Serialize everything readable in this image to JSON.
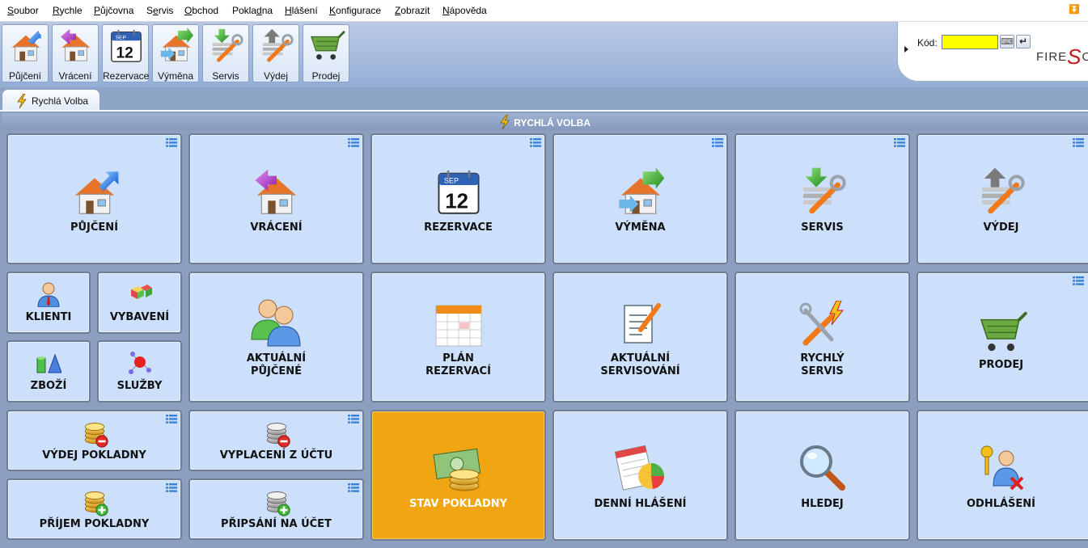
{
  "menu": [
    {
      "pre": "",
      "u": "S",
      "post": "oubor"
    },
    {
      "pre": "",
      "u": "R",
      "post": "ychle"
    },
    {
      "pre": "",
      "u": "P",
      "post": "ůjčovna"
    },
    {
      "pre": "S",
      "u": "e",
      "post": "rvis"
    },
    {
      "pre": "",
      "u": "O",
      "post": "bchod"
    },
    {
      "pre": "Pokla",
      "u": "d",
      "post": "na"
    },
    {
      "pre": "",
      "u": "H",
      "post": "lášení"
    },
    {
      "pre": "",
      "u": "K",
      "post": "onfigurace"
    },
    {
      "pre": "",
      "u": "Z",
      "post": "obrazit"
    },
    {
      "pre": "",
      "u": "N",
      "post": "ápověda"
    }
  ],
  "toolbar": [
    "Půjčení",
    "Vrácení",
    "Rezervace",
    "Výměna",
    "Servis",
    "Výdej",
    "Prodej"
  ],
  "code": {
    "label": "Kód:",
    "value": "",
    "logo_pre": "FIRE",
    "logo_s": "S",
    "logo_post": "OF"
  },
  "tab_label": "Rychlá Volba",
  "panel_title": "RYCHLÁ VOLBA",
  "calendar": {
    "month": "SEP",
    "day": "12"
  },
  "tiles": {
    "pujceni": "PŮJČENÍ",
    "vraceni": "VRÁCENÍ",
    "rezervace": "REZERVACE",
    "vymena": "VÝMĚNA",
    "servis": "SERVIS",
    "vydej": "VÝDEJ",
    "klienti": "KLIENTI",
    "vybaveni": "VYBAVENÍ",
    "zbozi": "ZBOŽÍ",
    "sluzby": "SLUŽBY",
    "aktualni_pujcene_1": "AKTUÁLNÍ",
    "aktualni_pujcene_2": "PŮJČENÉ",
    "plan_rezervaci_1": "PLÁN",
    "plan_rezervaci_2": "REZERVACÍ",
    "aktualni_servisovani_1": "AKTUÁLNÍ",
    "aktualni_servisovani_2": "SERVISOVÁNÍ",
    "rychly_servis_1": "RYCHLÝ",
    "rychly_servis_2": "SERVIS",
    "prodej": "PRODEJ",
    "vydej_pokladny": "VÝDEJ POKLADNY",
    "vyplaceni_z_uctu": "VYPLACENÍ Z ÚČTU",
    "stav_pokladny": "STAV POKLADNY",
    "denni_hlaseni": "DENNÍ HLÁŠENÍ",
    "hledej": "HLEDEJ",
    "odhlaseni": "ODHLÁŠENÍ",
    "prijem_pokladny": "PŘÍJEM POKLADNY",
    "pripsani_na_ucet": "PŘIPSÁNÍ NA ÚČET"
  },
  "colors": {
    "tile_bg": "#cce0fc",
    "tile_active": "#f2a512",
    "code_input": "#ffff00",
    "toolbar_bg": "#a7bbdd"
  },
  "icons": {
    "toolbar": [
      "house-arrow-icon",
      "house-return-icon",
      "calendar-icon",
      "exchange-icon",
      "service-tools-icon",
      "issue-tools-icon",
      "shopping-cart-icon"
    ],
    "tiles": [
      "house-arrow-icon",
      "house-return-icon",
      "calendar-icon",
      "exchange-icon",
      "service-tools-icon",
      "issue-tools-icon",
      "client-icon",
      "equipment-cubes-icon",
      "goods-shapes-icon",
      "services-molecule-icon",
      "users-icon",
      "planner-icon",
      "checklist-icon",
      "quick-service-icon",
      "shopping-cart-icon",
      "coins-minus-icon",
      "coins-minus-icon",
      "cash-coins-icon",
      "report-chart-icon",
      "magnifier-icon",
      "logout-keys-icon",
      "coins-plus-icon",
      "coins-plus-icon"
    ]
  }
}
